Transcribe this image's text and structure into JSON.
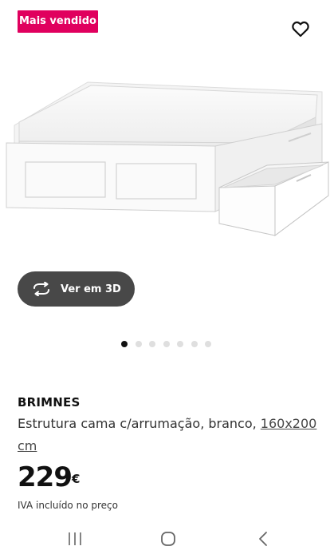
{
  "badge": {
    "label": "Mais vendido",
    "color": "#e0005e"
  },
  "favorite": {
    "icon": "heart-outline-icon"
  },
  "product_image": {
    "alt": "BRIMNES bed frame with storage drawers"
  },
  "view_3d": {
    "label": "Ver em 3D",
    "icon": "rotate-arrows-icon"
  },
  "carousel": {
    "total": 7,
    "active": 1
  },
  "product": {
    "name": "BRIMNES",
    "description": "Estrutura cama c/arrumação, branco, ",
    "size_link": "160x200 cm",
    "price": "229",
    "currency": "€",
    "vat_note": "IVA incluído no preço"
  },
  "system_nav": {
    "recents_icon": "recents-icon",
    "home_icon": "home-icon",
    "back_icon": "back-icon"
  }
}
